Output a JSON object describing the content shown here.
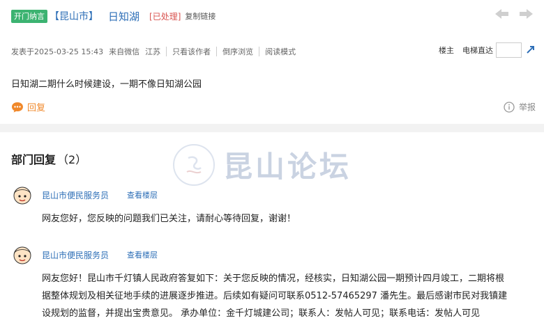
{
  "thread": {
    "badge": "开门纳言",
    "city": "【昆山市】",
    "title": "日知湖",
    "status": "[已处理]",
    "copy_link": "复制链接"
  },
  "meta": {
    "posted": "发表于2025-03-25 15:43",
    "source": "来自微信",
    "region": "江苏",
    "author_only": "只看该作者",
    "reverse": "倒序浏览",
    "read_mode": "阅读模式"
  },
  "meta_right": {
    "floor_owner": "楼主",
    "elevator": "电梯直达",
    "floor_input_value": ""
  },
  "post": {
    "content": "日知湖二期什么时候建设，一期不像日知湖公园"
  },
  "actions": {
    "reply": "回复",
    "report": "举报"
  },
  "section": {
    "title": "部门回复",
    "count": "（2）"
  },
  "watermark": {
    "text": "昆山论坛"
  },
  "replies": [
    {
      "author": "昆山市便民服务员",
      "view_floor": "查看楼层",
      "lines": [
        "网友您好，您反映的问题我们已关注，请耐心等待回复，谢谢！"
      ]
    },
    {
      "author": "昆山市便民服务员",
      "view_floor": "查看楼层",
      "lines": [
        "网友您好！昆山市千灯镇人民政府答复如下：关于您反映的情况，经核实，日知湖公园一期预计四月竣工，二期将根",
        "据整体规划及相关征地手续的进展逐步推进。后续如有疑问可联系0512-57465297 潘先生。最后感谢市民对我镇建",
        "设规划的监督，并提出宝贵意见。 承办单位：金千灯城建公司；联系人：发帖人可见；联系电话：发帖人可见"
      ]
    }
  ],
  "colors": {
    "link": "#2e6fb7",
    "badge": "#3cb371",
    "status": "#d9534f",
    "reply_action": "#f0882a"
  },
  "icons": [
    "prev-arrow-icon",
    "next-arrow-icon",
    "floor-go-icon",
    "reply-icon",
    "info-icon",
    "avatar-icon",
    "watermark-logo-icon"
  ]
}
